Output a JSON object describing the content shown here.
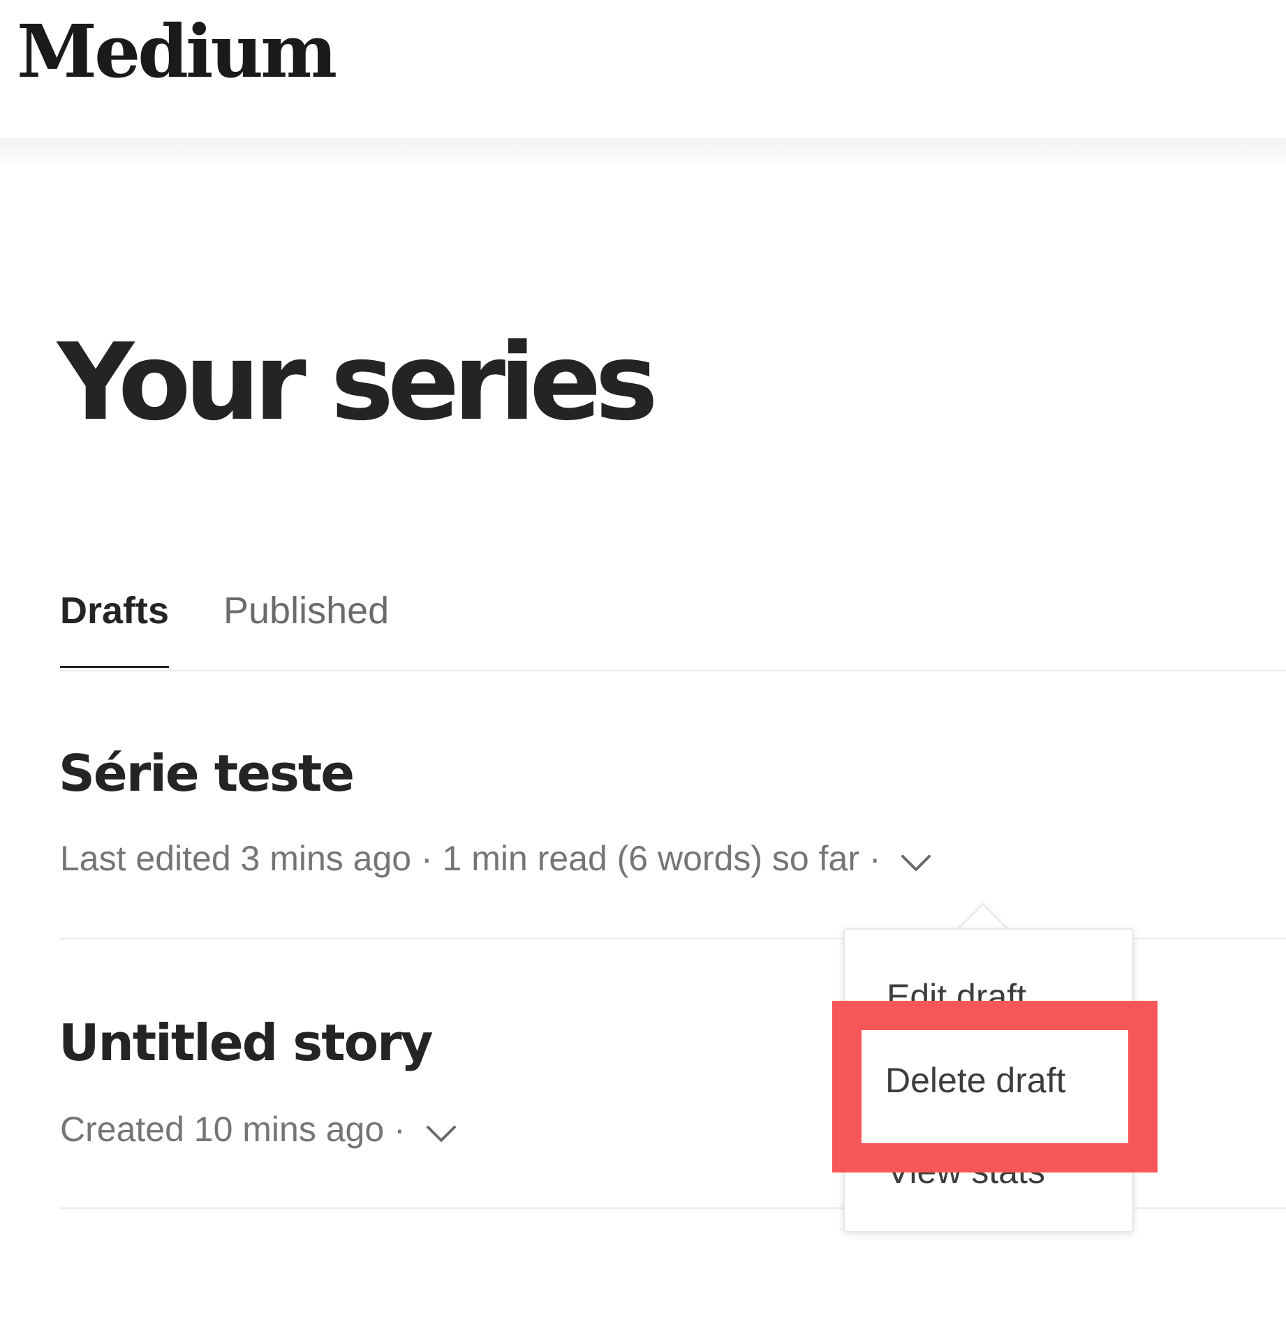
{
  "app": {
    "brand": "Medium"
  },
  "page": {
    "title": "Your series"
  },
  "tabs": [
    {
      "label": "Drafts",
      "active": true
    },
    {
      "label": "Published",
      "active": false
    }
  ],
  "stories": [
    {
      "title": "Série teste",
      "meta": "Last edited 3 mins ago · 1 min read (6 words) so far ·"
    },
    {
      "title": "Untitled story",
      "meta": "Created 10 mins ago ·"
    }
  ],
  "menu": {
    "items": [
      {
        "label": "Edit draft"
      },
      {
        "label": "Delete draft"
      },
      {
        "label": "View stats"
      }
    ]
  },
  "icons": {
    "dropdown": "chevron-down-icon"
  },
  "colors": {
    "highlight": "#f85759",
    "text_primary": "#242424",
    "text_secondary": "#757575"
  }
}
